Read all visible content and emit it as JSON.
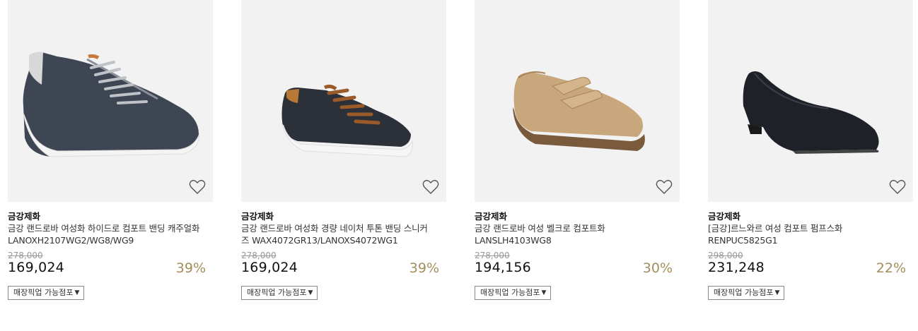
{
  "products": [
    {
      "brand": "금강제화",
      "name": "금강 랜드로바 여성화 하이드로 컴포트 밴딩 캐주얼화 LANOXH2107WG2/WG8/WG9",
      "original_price": "278,000",
      "price": "169,024",
      "discount": "39%",
      "pickup_label": "매장픽업 가능점포",
      "image": "navy-leather-elastic-lace-sneaker"
    },
    {
      "brand": "금강제화",
      "name": "금강 랜드로바 여성화 경량 네이처 투톤 밴딩 스니커즈 WAX4072GR13/LANOXS4072WG1",
      "original_price": "278,000",
      "price": "169,024",
      "discount": "39%",
      "pickup_label": "매장픽업 가능점포",
      "image": "black-leather-brown-lace-sneaker"
    },
    {
      "brand": "금강제화",
      "name": "금강 랜드로바 여성 벨크로 컴포트화 LANSLH4103WG8",
      "original_price": "278,000",
      "price": "194,156",
      "discount": "30%",
      "pickup_label": "매장픽업 가능점포",
      "image": "beige-velcro-comfort-shoe"
    },
    {
      "brand": "금강제화",
      "name": "[금강]르느와르 여성 컴포트 펌프스화 RENPUC5825G1",
      "original_price": "298,000",
      "price": "231,248",
      "discount": "22%",
      "pickup_label": "매장픽업 가능점포",
      "image": "black-leather-low-heel-pump"
    }
  ],
  "colors": {
    "thumb_bg": "#f2f2f2",
    "discount": "#a38d5d",
    "original_price": "#999999"
  },
  "icons": {
    "wishlist": "heart-outline-icon",
    "dropdown": "caret-down-icon"
  }
}
